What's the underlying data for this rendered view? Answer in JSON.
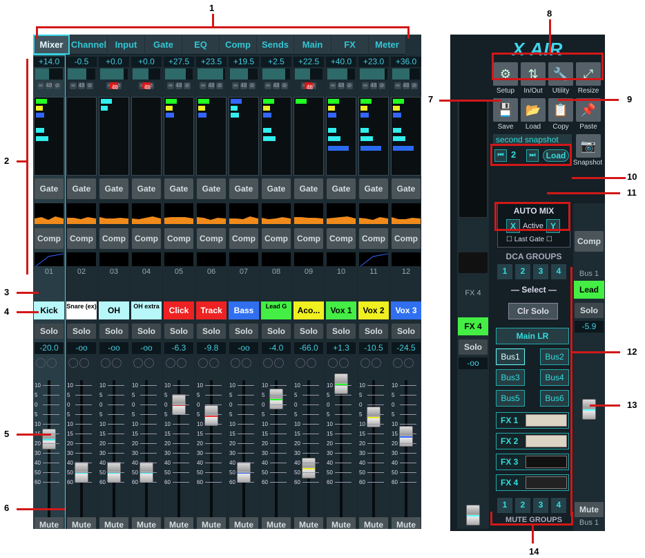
{
  "tabs": [
    "Mixer",
    "Channel",
    "Input",
    "Gate",
    "EQ",
    "Comp",
    "Sends",
    "Main",
    "FX",
    "Meter"
  ],
  "channels": [
    {
      "num": "01",
      "name": "Kick",
      "gain": "+14.0",
      "fader": "-20.0",
      "color": "#b7f7fa"
    },
    {
      "num": "02",
      "name": "Snare (ex)",
      "gain": "-0.5",
      "fader": "-oo",
      "color": "#ffffff"
    },
    {
      "num": "03",
      "name": "OH",
      "gain": "+0.0",
      "fader": "-oo",
      "color": "#b7f7fa"
    },
    {
      "num": "04",
      "name": "OH extra",
      "gain": "+0.0",
      "fader": "-oo",
      "color": "#b7f7fa"
    },
    {
      "num": "05",
      "name": "Click",
      "gain": "+27.5",
      "fader": "-6.3",
      "color": "#ee2222"
    },
    {
      "num": "06",
      "name": "Track",
      "gain": "+23.5",
      "fader": "-9.8",
      "color": "#ee2222"
    },
    {
      "num": "07",
      "name": "Bass",
      "gain": "+19.5",
      "fader": "-oo",
      "color": "#2f6ff0"
    },
    {
      "num": "08",
      "name": "Lead G",
      "gain": "+2.5",
      "fader": "-4.0",
      "color": "#44ee44"
    },
    {
      "num": "09",
      "name": "Aco...",
      "gain": "+22.5",
      "fader": "-66.0",
      "color": "#f0f020"
    },
    {
      "num": "10",
      "name": "Vox 1",
      "gain": "+40.0",
      "fader": "+1.3",
      "color": "#44ee44"
    },
    {
      "num": "11",
      "name": "Vox 2",
      "gain": "+23.0",
      "fader": "-10.5",
      "color": "#f0f020"
    },
    {
      "num": "12",
      "name": "Vox 3",
      "gain": "+36.0",
      "fader": "-24.5",
      "color": "#2f6ff0"
    }
  ],
  "labels": {
    "gate": "Gate",
    "comp": "Comp",
    "solo": "Solo",
    "mute": "Mute",
    "fx4": "FX 4",
    "bus1": "Bus 1",
    "lead": "Lead",
    "bus_fader": "-5.9",
    "phantom": "48"
  },
  "right": {
    "logo": "X AIR",
    "tools": [
      "Setup",
      "In/Out",
      "Utility",
      "Resize"
    ],
    "actions": [
      "Save",
      "Load",
      "Copy",
      "Paste"
    ],
    "snapshot_name": "second snapshot",
    "snapshot_num": "2",
    "snapshot_load": "Load",
    "snapshot": "Snapshot",
    "automix": "AUTO MIX",
    "x": "X",
    "active": "Active",
    "y": "Y",
    "lastgate": "Last Gate",
    "dca": "DCA GROUPS",
    "select": "Select",
    "clrsolo": "Clr Solo",
    "mainlr": "Main LR",
    "buses": [
      "Bus1",
      "Bus2",
      "Bus3",
      "Bus4",
      "Bus5",
      "Bus6"
    ],
    "fx": [
      "FX 1",
      "FX 2",
      "FX 3",
      "FX 4"
    ],
    "mute_groups": "MUTE GROUPS",
    "nums": [
      "1",
      "2",
      "3",
      "4"
    ]
  },
  "scale": [
    "10",
    "5",
    "0",
    "5",
    "10",
    "15",
    "20",
    "30",
    "40",
    "50",
    "60"
  ],
  "callouts": [
    "1",
    "2",
    "3",
    "4",
    "5",
    "6",
    "7",
    "8",
    "9",
    "10",
    "11",
    "12",
    "13",
    "14"
  ]
}
